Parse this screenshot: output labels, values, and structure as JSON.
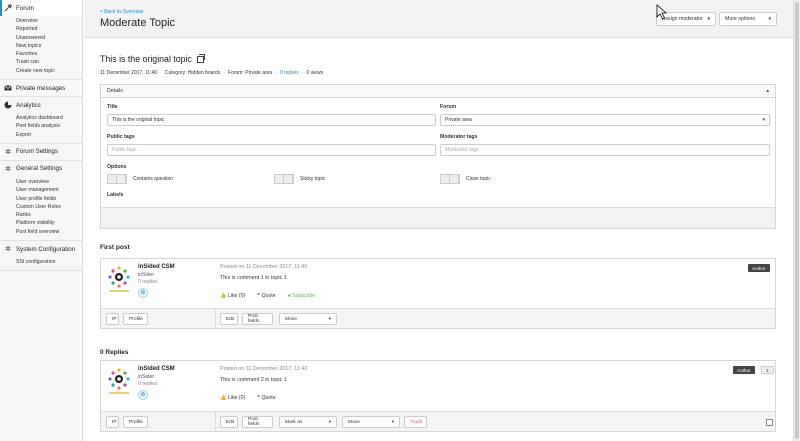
{
  "sidebar": {
    "forum": {
      "label": "Forum",
      "items": [
        "Overview",
        "Reported",
        "Unanswered",
        "New topics",
        "Favorites",
        "Trash can",
        "Create new topic"
      ]
    },
    "private_messages": {
      "label": "Private messages"
    },
    "analytics": {
      "label": "Analytics",
      "items": [
        "Analytics dashboard",
        "Post fields analysis",
        "Export"
      ]
    },
    "forum_settings": {
      "label": "Forum Settings"
    },
    "general_settings": {
      "label": "General Settings",
      "items": [
        "User overview",
        "User management",
        "User profile fields",
        "Custom User Roles",
        "Ranks",
        "Platform visibility",
        "Post field overview"
      ]
    },
    "system_configuration": {
      "label": "System Configuration",
      "items": [
        "SSI configuration"
      ]
    }
  },
  "header": {
    "back_link": "< Back to Overview",
    "title": "Moderate Topic",
    "assign_moderator": "Assign moderator",
    "more_options": "More options"
  },
  "topic": {
    "title": "This is the original topic",
    "date": "11 December 2017, 11:40",
    "category": "Category: Hidden boards",
    "forum": "Forum: Private area",
    "replies": "0 replies",
    "views": "0 views",
    "sep": "·"
  },
  "details": {
    "header": "Details",
    "title_label": "Title",
    "title_value": "This is the original topic",
    "forum_label": "Forum",
    "forum_value": "Private area",
    "public_tags_label": "Public tags",
    "public_tags_placeholder": "Public tags",
    "moderator_tags_label": "Moderator tags",
    "moderator_tags_placeholder": "Moderator tags",
    "options_label": "Options",
    "option_question": "Contains question",
    "option_sticky": "Sticky topic",
    "option_close": "Close topic",
    "labels_label": "Labels"
  },
  "first_post": {
    "section_title": "First post",
    "user_name": "inSided CSM",
    "user_role": "inSider",
    "user_replies": "0 replies",
    "posted_on": "Posted on 11 December 2017, 11:40",
    "text": "This is comment 1 in topic 1",
    "like": "Like (0)",
    "quote": "Quote",
    "subscribe": "Subscribe",
    "badge": "Author",
    "ip": "IP",
    "profile": "Profile",
    "edit": "Edit",
    "post_fields": "Post fields",
    "move": "Move"
  },
  "replies": {
    "section_title": "0 Replies",
    "user_name": "inSided CSM",
    "user_role": "inSider",
    "user_replies": "0 replies",
    "posted_on": "Posted on 11 December 2017, 11:42",
    "text": "This is comment 2 in topic 1",
    "like": "Like (0)",
    "quote": "Quote",
    "badge": "Author",
    "badge_count": "1",
    "ip": "IP",
    "profile": "Profile",
    "edit": "Edit",
    "post_fields": "Post fields",
    "mark_as": "Mark as",
    "move": "Move",
    "trash": "Trash"
  },
  "colors": {
    "accent": "#1d8fcf",
    "subscribe": "#5bb85b",
    "danger": "#d9534f",
    "badge_bg": "#444444"
  }
}
